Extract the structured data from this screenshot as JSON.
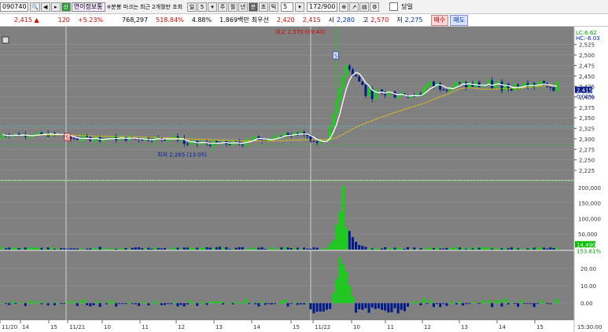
{
  "toolbar": {
    "code": "090740",
    "badge": "신",
    "name": "연이정보통",
    "notice": "※분봉 마크는 최근 2개월만 조회",
    "periods": [
      "일",
      "5",
      "주",
      "월",
      "년",
      "분",
      "초",
      "틱"
    ],
    "interval": "5",
    "count": "172",
    "count_total": "/900",
    "today_label": "당일"
  },
  "quote": {
    "price": "2,415",
    "change": "120",
    "change_pct": "+5.23%",
    "volume": "768,297",
    "vol_ratio": "518.84%",
    "turnover": "4.88%",
    "amount": "1.869백만",
    "best_label": "최우선",
    "best_ask": "2,420",
    "best_bid": "2,415",
    "open_label": "시",
    "open": "2,280",
    "high_label": "고",
    "high": "2,570",
    "low_label": "저",
    "low": "2,275",
    "buy_label": "매수",
    "sell_label": "매도"
  },
  "chart_data": {
    "type": "candlestick",
    "price_ticks": [
      "2,525",
      "2,500",
      "2,475",
      "2,450",
      "2,425",
      "2,400",
      "2,375",
      "2,350",
      "2,325",
      "2,300",
      "2,275",
      "2,250",
      "2,225"
    ],
    "price_range": [
      2210,
      2560
    ],
    "lc_label": "LC:6.62",
    "hc_label": "HC:-6.03",
    "last_price_label": "2,415",
    "last_price_pct": "0.00%",
    "high_annotation": "최고 2,570 (09:40)",
    "low_annotation": "최저 2,265 (13:05)",
    "marker_s": "S",
    "marker_d": "S",
    "volume_ticks": [
      "200,000",
      "150,000",
      "100,000",
      "50,000"
    ],
    "volume_max": 210000,
    "last_volume_label": "14,490",
    "last_volume_pct": "153.61%",
    "osc_ticks": [
      "20.00",
      "10.00",
      "0.00"
    ],
    "osc_range": [
      -8,
      28
    ],
    "x_labels": [
      "11/20",
      "14",
      "15",
      "11/21",
      "10",
      "11",
      "12",
      "13",
      "14",
      "15",
      "11/22",
      "10",
      "11",
      "12",
      "13",
      "14",
      "15"
    ],
    "time_label": "15:30:00"
  }
}
